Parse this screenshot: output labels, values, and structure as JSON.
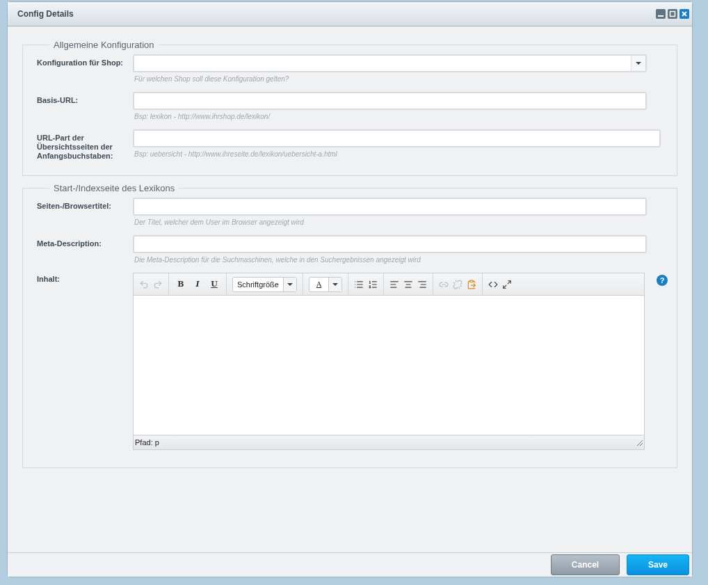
{
  "window": {
    "title": "Config Details"
  },
  "sections": [
    {
      "legend": "Allgemeine Konfiguration",
      "fields": [
        {
          "kind": "select",
          "label": "Konfiguration für Shop:",
          "hint": "Für welchen Shop soll diese Konfiguration gelten?"
        },
        {
          "kind": "text",
          "label": "Basis-URL:",
          "hint": "Bsp: lexikon - http://www.ihrshop.de/lexikon/"
        },
        {
          "kind": "wide",
          "label": "URL-Part der Übersichtsseiten der Anfangsbuchstaben:",
          "hint": "Bsp: uebersicht - http://www.ihreseite.de/lexikon/uebersicht-a.html"
        }
      ]
    },
    {
      "legend": "Start-/Indexseite des Lexikons",
      "fields": [
        {
          "kind": "text",
          "label": "Seiten-/Browsertitel:",
          "hint": "Der Titel, welcher dem User im Browser angezeigt wird"
        },
        {
          "kind": "text",
          "label": "Meta-Description:",
          "hint": "Die Meta-Description für die Suchmaschinen, welche in den Suchergebnissen angezeigt wird"
        },
        {
          "kind": "editor",
          "label": "Inhalt:",
          "help": "?",
          "toolbar": {
            "undo_disabled": true,
            "redo_disabled": true,
            "format_buttons": [
              "B",
              "I",
              "U"
            ],
            "font_size": "Schriftgröße",
            "text_color": "A",
            "link_disabled": true,
            "unlink_disabled": true
          },
          "status": "Pfad: p"
        }
      ]
    }
  ],
  "buttons": [
    {
      "kind": "secondary",
      "label": "Cancel"
    },
    {
      "kind": "primary",
      "label": "Save"
    }
  ]
}
